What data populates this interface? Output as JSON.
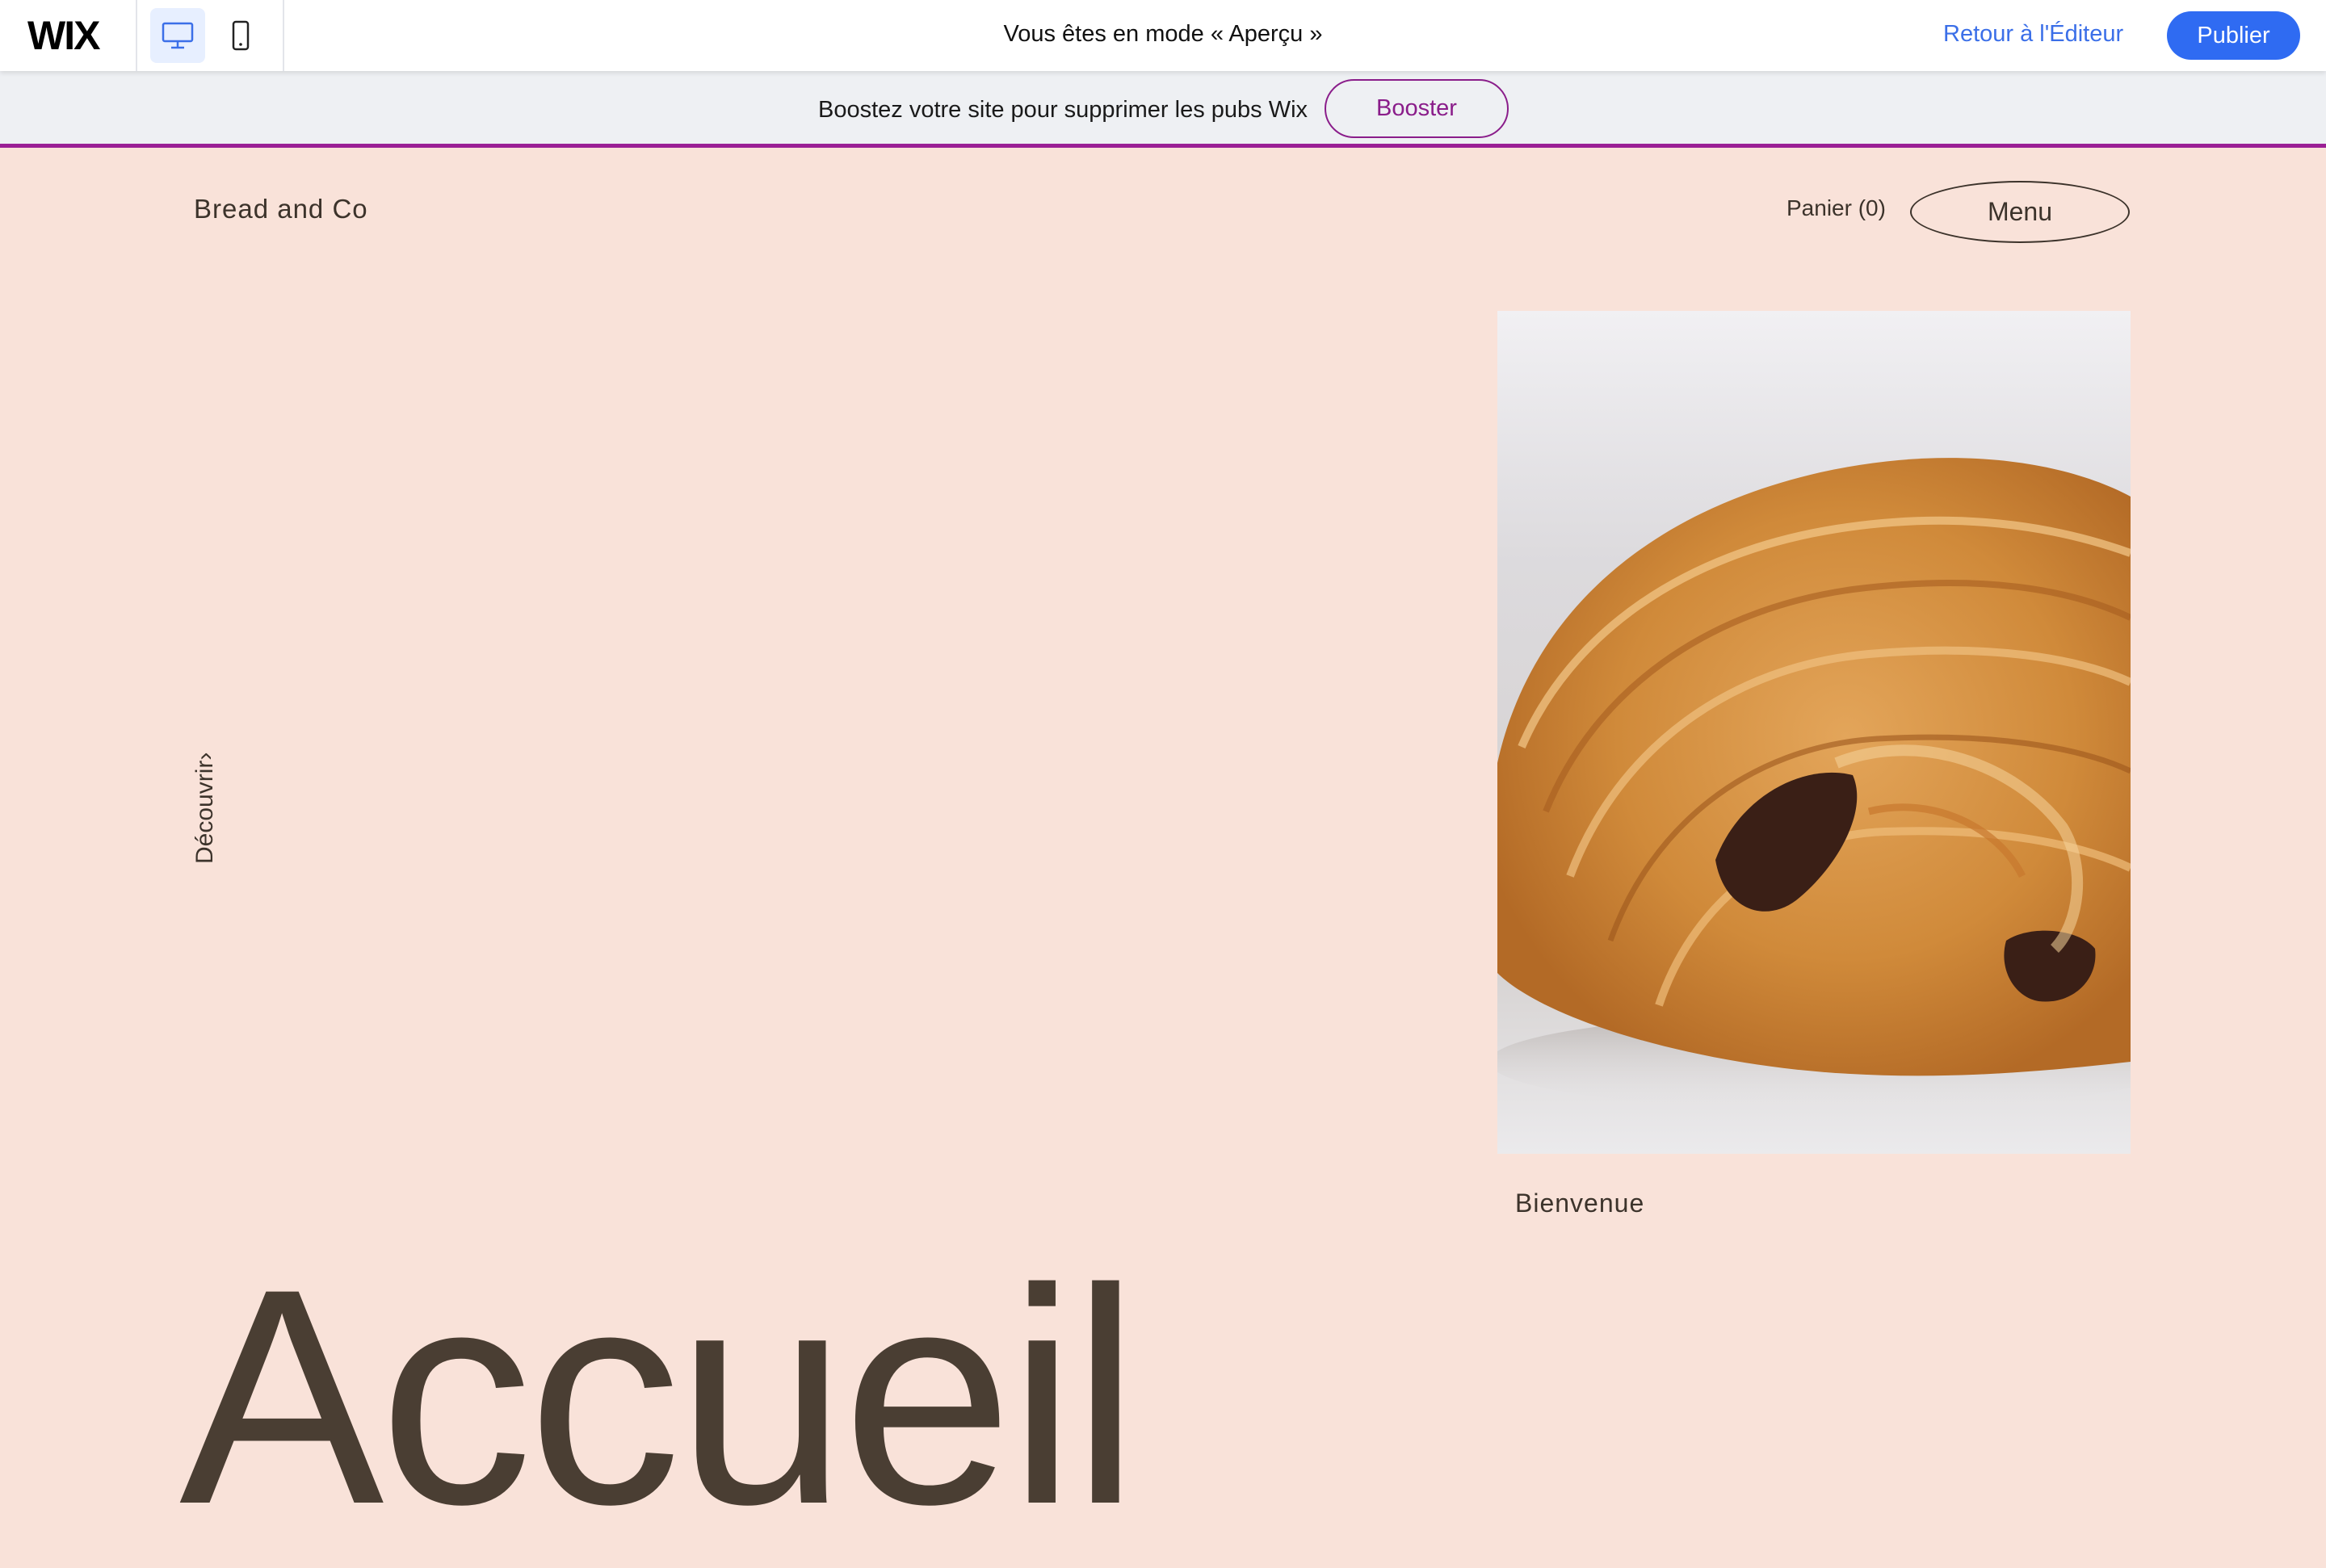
{
  "topbar": {
    "logo": "WIX",
    "preview_title": "Vous êtes en mode « Aperçu »",
    "back_label": "Retour à l'Éditeur",
    "publish_label": "Publier",
    "devices": [
      {
        "name": "desktop",
        "icon": "desktop-icon",
        "active": true
      },
      {
        "name": "mobile",
        "icon": "mobile-icon",
        "active": false
      }
    ]
  },
  "adbar": {
    "text": "Boostez votre site pour supprimer les pubs Wix",
    "button_label": "Booster"
  },
  "site": {
    "name": "Bread and Co",
    "cart_label": "Panier (0)",
    "menu_label": "Menu",
    "discover_label": "Découvrir›",
    "image_icon": "pain-au-chocolat-photo",
    "caption": "Bienvenue",
    "title": "Accueil"
  },
  "colors": {
    "page_bg": "#f9e2d9",
    "accent_blue": "#2f6bf2",
    "ad_purple": "#9b1f95",
    "text_dark": "#3c332b"
  }
}
